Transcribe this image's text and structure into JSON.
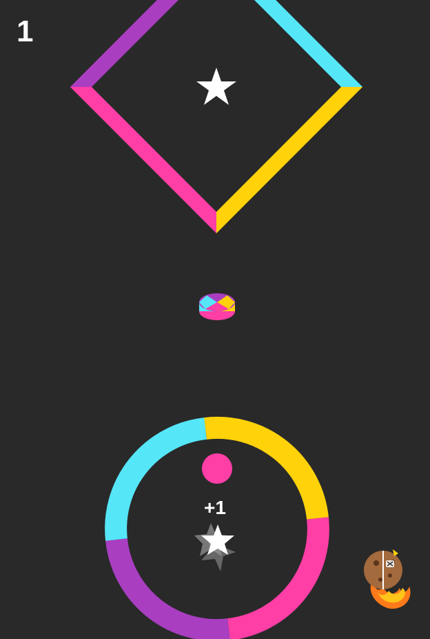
{
  "hud": {
    "score": "1"
  },
  "popup": {
    "bonus": "+1"
  },
  "colors": {
    "background": "#292929",
    "cyan": "#55e6f8",
    "yellow": "#ffd20a",
    "magenta": "#ff3ea6",
    "purple": "#a93ec1",
    "white": "#ffffff"
  },
  "icons": {
    "star": "star-icon",
    "color_switcher": "color-switcher-icon",
    "ball": "player-ball",
    "mascot": "cookie-mascot-icon"
  }
}
